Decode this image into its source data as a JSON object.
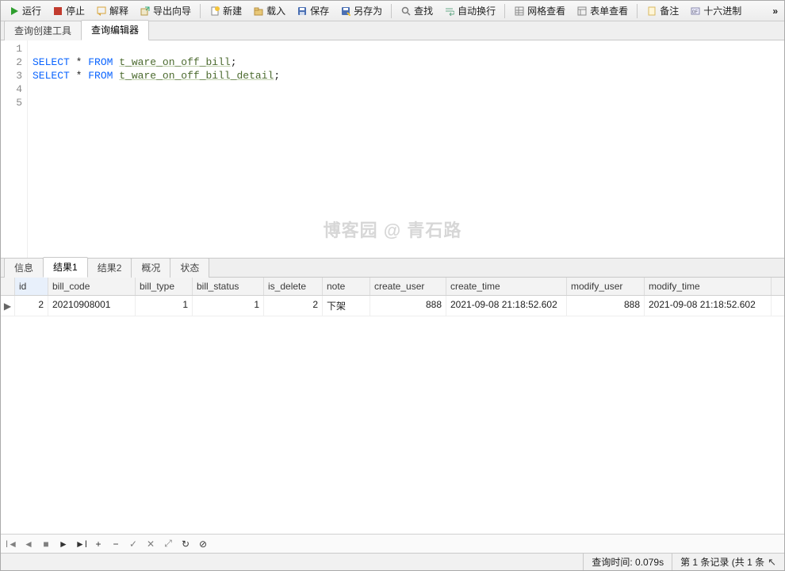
{
  "toolbar": {
    "run": "运行",
    "stop": "停止",
    "explain": "解释",
    "export_wizard": "导出向导",
    "new": "新建",
    "load": "载入",
    "save": "保存",
    "save_as": "另存为",
    "find": "查找",
    "wrap": "自动换行",
    "grid_view": "网格查看",
    "form_view": "表单查看",
    "notes": "备注",
    "hex": "十六进制",
    "overflow": "»"
  },
  "editor_tabs": {
    "builder": "查询创建工具",
    "editor": "查询编辑器"
  },
  "sql": {
    "lines": [
      "1",
      "2",
      "3",
      "4",
      "5"
    ],
    "kw_select": "SELECT",
    "kw_from": "FROM",
    "star": "*",
    "tbl1": "t_ware_on_off_bill",
    "tbl2": "t_ware_on_off_bill_detail",
    "semi": ";"
  },
  "watermark": "博客园 @ 青石路",
  "result_tabs": {
    "info": "信息",
    "r1": "结果1",
    "r2": "结果2",
    "profile": "概况",
    "status": "状态"
  },
  "columns": {
    "id": "id",
    "bill_code": "bill_code",
    "bill_type": "bill_type",
    "bill_status": "bill_status",
    "is_delete": "is_delete",
    "note": "note",
    "create_user": "create_user",
    "create_time": "create_time",
    "modify_user": "modify_user",
    "modify_time": "modify_time"
  },
  "row": {
    "marker": "▶",
    "id": "2",
    "bill_code": "20210908001",
    "bill_type": "1",
    "bill_status": "1",
    "is_delete": "2",
    "note": "下架",
    "create_user": "888",
    "create_time": "2021-09-08 21:18:52.602",
    "modify_user": "888",
    "modify_time": "2021-09-08 21:18:52.602"
  },
  "recnav": {
    "first": "ǀ◄",
    "prev": "◄",
    "stop2": "■",
    "next": "►",
    "last": "►ǀ",
    "plus": "+",
    "minus": "−",
    "check": "✓",
    "cross": "✕",
    "dbl": "⤢",
    "refresh": "↻",
    "cancel": "⊘"
  },
  "status": {
    "query_time": "查询时间: 0.079s",
    "record_pos": "第 1 条记录 (共 1 条"
  }
}
